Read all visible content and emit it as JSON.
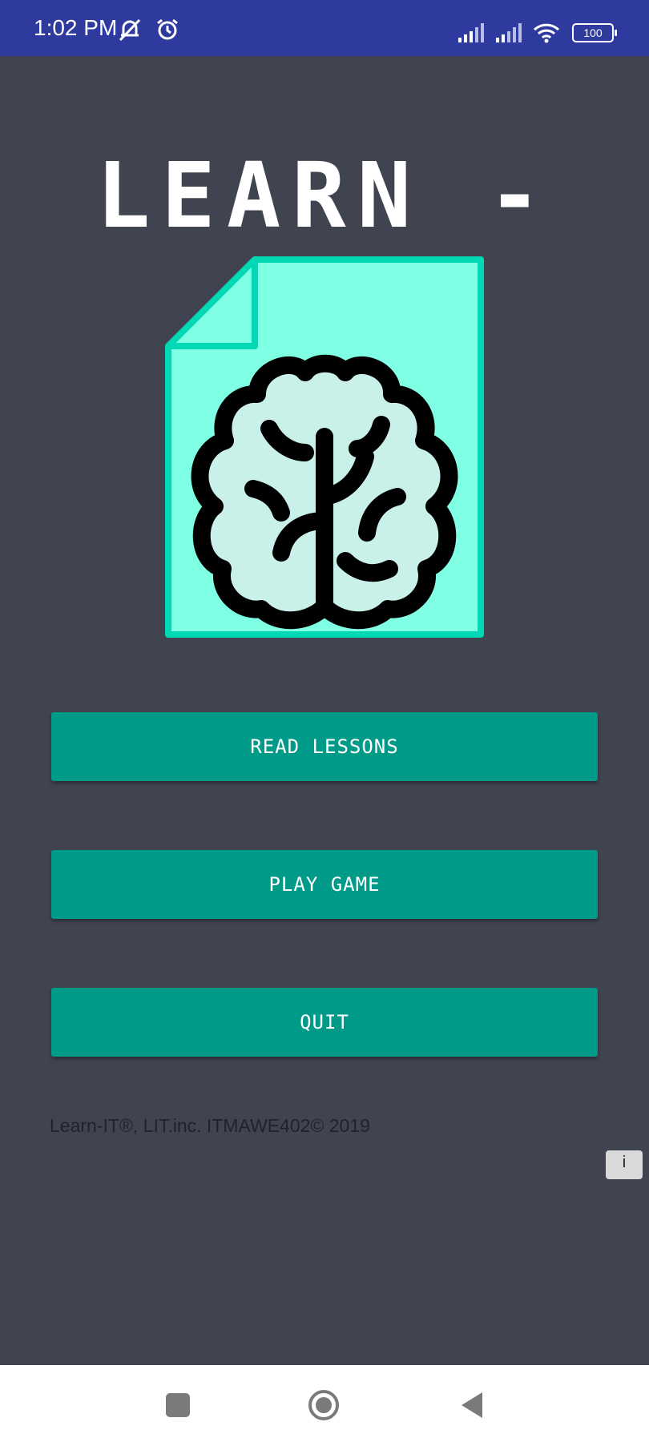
{
  "status_bar": {
    "time": "1:02 PM",
    "battery": "100",
    "icons": [
      "mute-bell-icon",
      "alarm-icon",
      "signal-icon",
      "signal-icon",
      "wifi-icon",
      "battery-icon"
    ]
  },
  "app": {
    "title": "LEARN - IT",
    "logo": "brain-document-icon"
  },
  "menu": {
    "read_lessons": "READ LESSONS",
    "play_game": "PLAY GAME",
    "quit": "QUIT"
  },
  "footer": {
    "copyright": "Learn-IT®, LIT.inc. ITMAWE402© 2019",
    "info": "i"
  },
  "nav_bar": {
    "icons": [
      "square-icon",
      "circle-home-icon",
      "back-triangle-icon"
    ]
  },
  "colors": {
    "status_bar": "#2f3a9e",
    "background": "#3f4450",
    "button": "#009a88",
    "logo_paper": "#7fffe4",
    "logo_border": "#00d9b3",
    "brain_fill": "#c9f1ea"
  }
}
